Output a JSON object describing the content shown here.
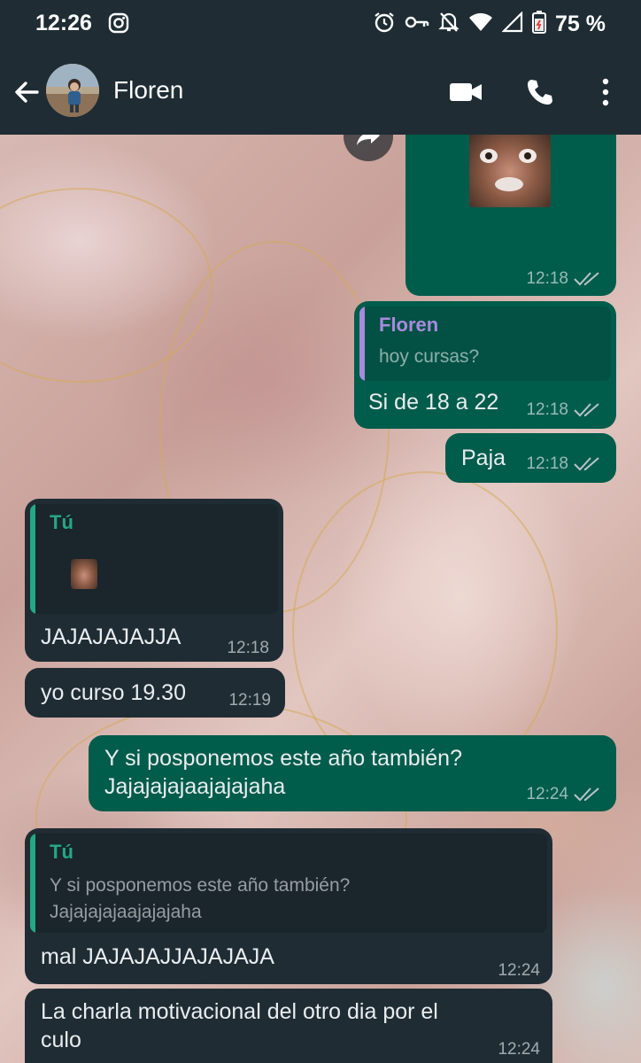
{
  "status_bar": {
    "time": "12:26",
    "battery": "75 %",
    "icons": [
      "instagram-icon",
      "alarm-icon",
      "vpn-key-icon",
      "mute-icon",
      "wifi-icon",
      "signal-icon",
      "battery-icon"
    ]
  },
  "header": {
    "contact_name": "Floren",
    "back_label": "←",
    "actions": [
      "video-call-icon",
      "call-icon",
      "more-icon"
    ]
  },
  "messages": [
    {
      "id": "m1",
      "direction": "out",
      "time": "12:18",
      "type": "sticker"
    },
    {
      "id": "m2",
      "direction": "out",
      "time": "12:18",
      "quote_author": "Floren",
      "quote_text": "hoy cursas?",
      "text": "Si de 18 a 22"
    },
    {
      "id": "m3",
      "direction": "out",
      "time": "12:18",
      "text": "Paja"
    },
    {
      "id": "m4",
      "direction": "in",
      "time": "12:18",
      "quote_author": "Tú",
      "text": "JAJAJAJAJJA"
    },
    {
      "id": "m5",
      "direction": "in",
      "time": "12:19",
      "text": "yo curso 19.30"
    },
    {
      "id": "m6",
      "direction": "out",
      "time": "12:24",
      "text_line1": "Y si posponemos este año también?",
      "text_line2": "Jajajajajaajajajaha"
    },
    {
      "id": "m7",
      "direction": "in",
      "time": "12:24",
      "quote_author": "Tú",
      "quote_line1": "Y si posponemos este año también?",
      "quote_line2": "Jajajajajaajajajaha",
      "text": "mal JAJAJAJJAJAJAJA"
    },
    {
      "id": "m8",
      "direction": "in",
      "time": "12:24",
      "text_line1": "La charla motivacional del otro dia por el",
      "text_line2": "culo"
    }
  ],
  "colors": {
    "header_bg": "#1f2c34",
    "outgoing_bubble": "#005c4b",
    "incoming_bubble": "#1f2c34",
    "quote_author_floren": "#a78bdc",
    "quote_author_tu": "#25a884",
    "read_ticks": "#b8c4c9"
  }
}
